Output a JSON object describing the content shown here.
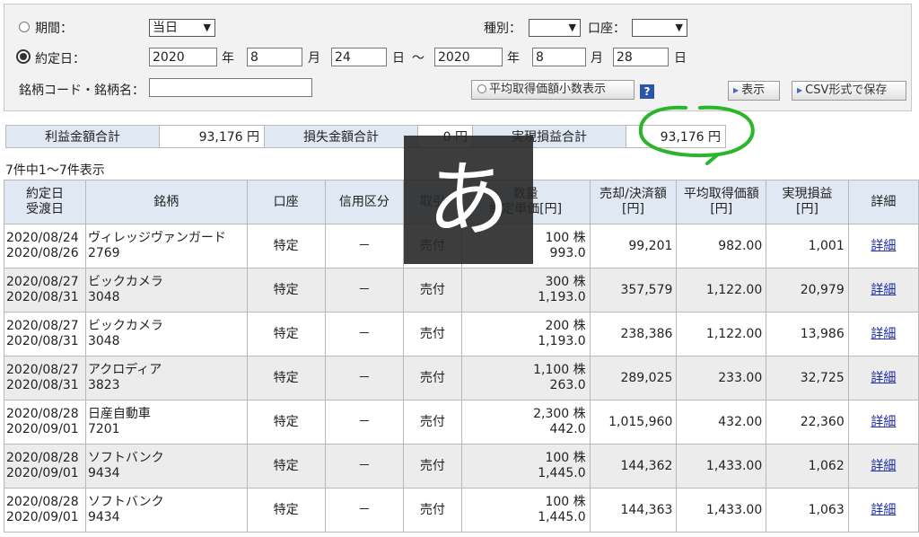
{
  "filters": {
    "period_label": "期間：",
    "period_value": "当日",
    "type_label": "種別：",
    "type_value": "",
    "account_label": "口座：",
    "account_value": "",
    "trade_date_label": "約定日：",
    "from_year": "2020",
    "from_month": "8",
    "from_day": "24",
    "to_year": "2020",
    "to_month": "8",
    "to_day": "28",
    "year_unit": "年",
    "month_unit": "月",
    "day_unit": "日",
    "tilde": "〜",
    "stock_label": "銘柄コード・銘柄名：",
    "stock_value": "",
    "avg_price_decimal_label": "平均取得価額小数表示",
    "help_label": "?",
    "show_button": "表示",
    "csv_button": "CSV形式で保存"
  },
  "summary": {
    "profit_label": "利益金額合計",
    "profit_value": "93,176 円",
    "loss_label": "損失金額合計",
    "loss_value": "0 円",
    "realized_label": "実現損益合計",
    "realized_value": "93,176 円"
  },
  "count_text": "7件中1〜7件表示",
  "ime_indicator": "あ",
  "table": {
    "headers": {
      "date_1": "約定日",
      "date_2": "受渡日",
      "stock": "銘柄",
      "account": "口座",
      "margin": "信用区分",
      "trade_1": "取引",
      "qty_1": "数量",
      "qty_2": "約定単価[円]",
      "sale_1": "売却/決済額",
      "sale_2": "[円]",
      "avg_1": "平均取得価額",
      "avg_2": "[円]",
      "pl_1": "実現損益",
      "pl_2": "[円]",
      "detail": "詳細"
    },
    "rows": [
      {
        "trade_date": "2020/08/24",
        "settle_date": "2020/08/26",
        "name": "ヴィレッジヴァンガード",
        "code": "2769",
        "account": "特定",
        "margin": "－",
        "trade": "売付",
        "qty": "100 株",
        "price": "993.0",
        "sale": "99,201",
        "avg": "982.00",
        "pl": "1,001",
        "detail": "詳細"
      },
      {
        "trade_date": "2020/08/27",
        "settle_date": "2020/08/31",
        "name": "ビックカメラ",
        "code": "3048",
        "account": "特定",
        "margin": "－",
        "trade": "売付",
        "qty": "300 株",
        "price": "1,193.0",
        "sale": "357,579",
        "avg": "1,122.00",
        "pl": "20,979",
        "detail": "詳細"
      },
      {
        "trade_date": "2020/08/27",
        "settle_date": "2020/08/31",
        "name": "ビックカメラ",
        "code": "3048",
        "account": "特定",
        "margin": "－",
        "trade": "売付",
        "qty": "200 株",
        "price": "1,193.0",
        "sale": "238,386",
        "avg": "1,122.00",
        "pl": "13,986",
        "detail": "詳細"
      },
      {
        "trade_date": "2020/08/27",
        "settle_date": "2020/08/31",
        "name": "アクロディア",
        "code": "3823",
        "account": "特定",
        "margin": "－",
        "trade": "売付",
        "qty": "1,100 株",
        "price": "263.0",
        "sale": "289,025",
        "avg": "233.00",
        "pl": "32,725",
        "detail": "詳細"
      },
      {
        "trade_date": "2020/08/28",
        "settle_date": "2020/09/01",
        "name": "日産自動車",
        "code": "7201",
        "account": "特定",
        "margin": "－",
        "trade": "売付",
        "qty": "2,300 株",
        "price": "442.0",
        "sale": "1,015,960",
        "avg": "432.00",
        "pl": "22,360",
        "detail": "詳細"
      },
      {
        "trade_date": "2020/08/28",
        "settle_date": "2020/09/01",
        "name": "ソフトバンク",
        "code": "9434",
        "account": "特定",
        "margin": "－",
        "trade": "売付",
        "qty": "100 株",
        "price": "1,445.0",
        "sale": "144,362",
        "avg": "1,433.00",
        "pl": "1,062",
        "detail": "詳細"
      },
      {
        "trade_date": "2020/08/28",
        "settle_date": "2020/09/01",
        "name": "ソフトバンク",
        "code": "9434",
        "account": "特定",
        "margin": "－",
        "trade": "売付",
        "qty": "100 株",
        "price": "1,445.0",
        "sale": "144,363",
        "avg": "1,433.00",
        "pl": "1,063",
        "detail": "詳細"
      }
    ]
  },
  "colors": {
    "header_bg": "#dfe8f3",
    "row_alt_bg": "#ececec",
    "link": "#1a2aa8",
    "annotation_green": "#2bb52b"
  }
}
